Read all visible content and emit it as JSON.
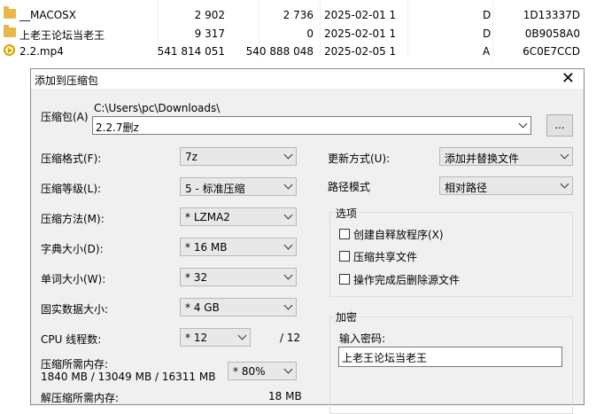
{
  "file_list": [
    {
      "name": "__MACOSX",
      "size": "2 902",
      "packed": "2 736",
      "modified": "2025-02-01 1",
      "attr": "D",
      "crc": "1D13337D",
      "icon": "folder-icon"
    },
    {
      "name": "上老王论坛当老王",
      "size": "9 317",
      "packed": "0",
      "modified": "2025-02-01 1",
      "attr": "D",
      "crc": "0B9058A0",
      "icon": "folder-icon"
    },
    {
      "name": "2.2.mp4",
      "size": "541 814 051",
      "packed": "540 888 048",
      "modified": "2025-02-05 1",
      "attr": "A",
      "crc": "6C0E7CCD",
      "icon": "video-file-icon"
    }
  ],
  "dialog": {
    "title": "添加到压缩包",
    "close": "✕",
    "archive_label": "压缩包(A)",
    "archive_dir": "C:\\Users\\pc\\Downloads\\",
    "archive_name": "2.2.7删z",
    "browse_label": "...",
    "format_label": "压缩格式(F):",
    "format_value": "7z",
    "level_label": "压缩等级(L):",
    "level_value": "5 - 标准压缩",
    "method_label": "压缩方法(M):",
    "method_value": "*  LZMA2",
    "dict_label": "字典大小(D):",
    "dict_value": "*  16 MB",
    "word_label": "单词大小(W):",
    "word_value": "*  32",
    "solid_label": "固实数据大小:",
    "solid_value": "*  4 GB",
    "threads_label": "CPU 线程数:",
    "threads_value": "*  12",
    "threads_total": "/ 12",
    "mem_label": "压缩所需内存:",
    "mem_values": "1840 MB / 13049 MB / 16311 MB",
    "mem_percent": "* 80%",
    "decomp_label": "解压缩所需内存:",
    "decomp_value": "18 MB",
    "update_label": "更新方式(U):",
    "update_value": "添加并替换文件",
    "path_label": "路径模式",
    "path_value": "相对路径",
    "options_title": "选项",
    "options": [
      "创建自释放程序(X)",
      "压缩共享文件",
      "操作完成后删除源文件"
    ],
    "encrypt_title": "加密",
    "password_label": "输入密码:",
    "password_value": "上老王论坛当老王"
  }
}
